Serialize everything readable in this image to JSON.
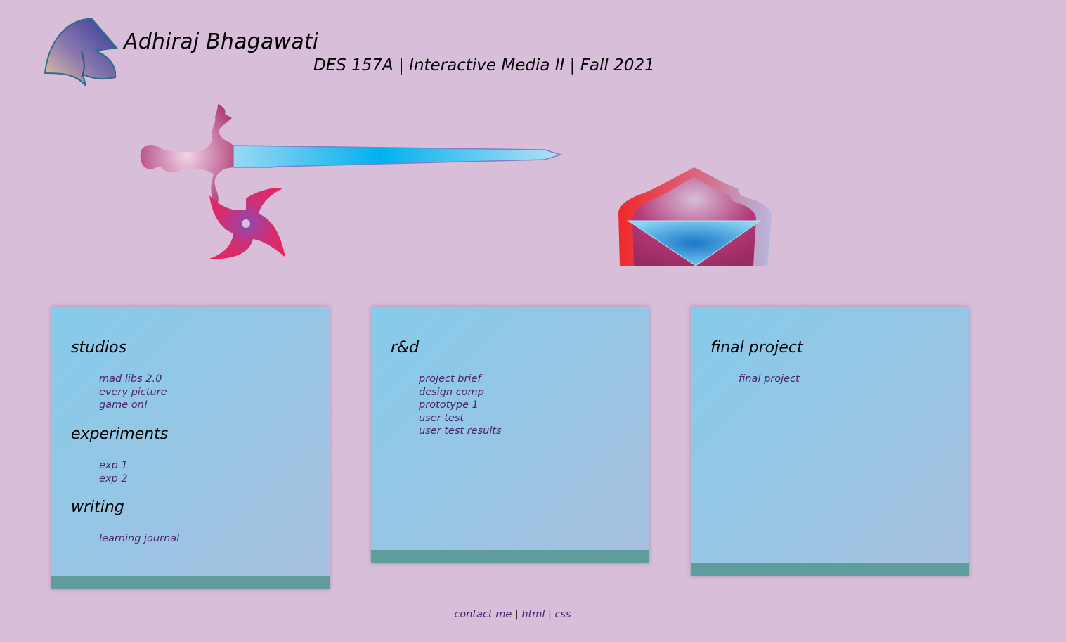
{
  "header": {
    "name": "Adhiraj Bhagawati",
    "course": "DES 157A | Interactive Media II | Fall 2021"
  },
  "columns": [
    {
      "sections": [
        {
          "title": "studios",
          "links": [
            "mad libs 2.0",
            "every picture",
            "game on!"
          ]
        },
        {
          "title": "experiments",
          "links": [
            "exp 1",
            "exp 2"
          ]
        },
        {
          "title": "writing",
          "links": [
            "learning journal"
          ]
        }
      ]
    },
    {
      "sections": [
        {
          "title": "r&d",
          "links": [
            "project brief",
            "design comp",
            "prototype 1",
            "user test",
            "user test results"
          ]
        }
      ]
    },
    {
      "sections": [
        {
          "title": "final project",
          "links": [
            "final project"
          ]
        }
      ]
    }
  ],
  "footer": {
    "contact": "contact me",
    "separator": "|",
    "html": "html",
    "css": "css"
  },
  "colors": {
    "background": "#d8bed8",
    "card_gradient_start": "#86cbea",
    "card_gradient_end": "#a8c0de",
    "card_footer": "#5f9c9d",
    "link": "#4a2270"
  }
}
